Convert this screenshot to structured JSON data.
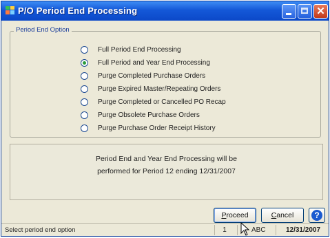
{
  "window": {
    "title": "P/O Period End Processing",
    "close_glyph": "✕"
  },
  "group": {
    "legend": "Period End Option",
    "options": [
      {
        "label": "Full Period End Processing",
        "checked": false
      },
      {
        "label": "Full Period and Year End Processing",
        "checked": true
      },
      {
        "label": "Purge Completed Purchase Orders",
        "checked": false
      },
      {
        "label": "Purge Expired Master/Repeating Orders",
        "checked": false
      },
      {
        "label": "Purge Completed or Cancelled PO Recap",
        "checked": false
      },
      {
        "label": "Purge Obsolete Purchase Orders",
        "checked": false
      },
      {
        "label": "Purge Purchase Order Receipt History",
        "checked": false
      }
    ]
  },
  "info": {
    "line1": "Period End and Year End Processing will be",
    "line2": "performed for Period 12 ending 12/31/2007"
  },
  "buttons": {
    "proceed_first": "P",
    "proceed_rest": "roceed",
    "cancel_first": "C",
    "cancel_rest": "ancel",
    "help_glyph": "?"
  },
  "status": {
    "message": "Select period end option",
    "cell1": "1",
    "cell2": "ABC",
    "date": "12/31/2007"
  },
  "colors": {
    "title_bar": "#1458d8",
    "selected_radio": "#2a9a3a",
    "help_button": "#1b5ad0"
  },
  "icons": {
    "app": "app-grid-icon",
    "minimize": "minimize-icon",
    "maximize": "maximize-icon",
    "close": "close-icon",
    "help": "help-icon",
    "pointer": "mouse-pointer-icon"
  }
}
